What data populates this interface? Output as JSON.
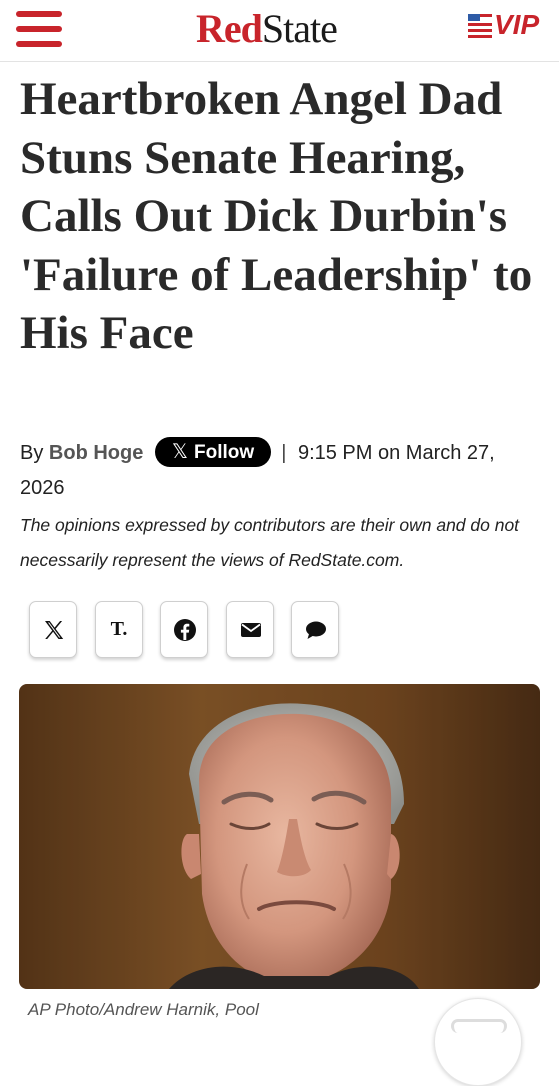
{
  "header": {
    "menu_icon": "hamburger-menu-icon",
    "logo_red": "Red",
    "logo_state": "State",
    "vip_label": "VIP",
    "brand_color": "#c8242b"
  },
  "article": {
    "headline": "Heartbroken Angel Dad Stuns Senate Hearing, Calls Out Dick Durbin's 'Failure of Leadership' to His Face",
    "by_prefix": "By",
    "author": "Bob Hoge",
    "follow_label": "Follow",
    "follow_icon": "x-logo-icon",
    "separator": "|",
    "timestamp": "9:15 PM on March 27, 2026",
    "disclaimer": "The opinions expressed by contributors are their own and do not necessarily represent the views of RedState.com."
  },
  "share": {
    "items": [
      {
        "name": "x",
        "icon": "x-logo-icon"
      },
      {
        "name": "truth-social",
        "icon": "truth-social-icon",
        "label": "T."
      },
      {
        "name": "facebook",
        "icon": "facebook-icon"
      },
      {
        "name": "email",
        "icon": "email-icon"
      },
      {
        "name": "comment",
        "icon": "comment-icon"
      }
    ]
  },
  "photo": {
    "caption": "AP Photo/Andrew Harnik, Pool"
  }
}
